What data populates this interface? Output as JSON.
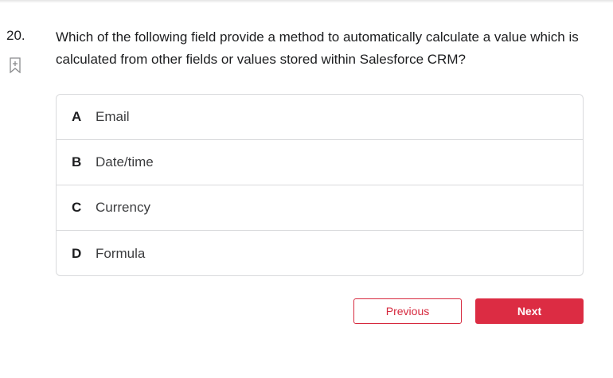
{
  "question": {
    "number": "20.",
    "text": "Which of the following field provide a method to automatically calculate a value which is calculated from other fields or values stored within Salesforce CRM?"
  },
  "options": [
    {
      "letter": "A",
      "text": "Email"
    },
    {
      "letter": "B",
      "text": "Date/time"
    },
    {
      "letter": "C",
      "text": "Currency"
    },
    {
      "letter": "D",
      "text": "Formula"
    }
  ],
  "nav": {
    "previous_label": "Previous",
    "next_label": "Next"
  },
  "colors": {
    "accent": "#dc2c43",
    "border": "#d9dadc",
    "text": "#1c1d1f"
  },
  "icons": {
    "bookmark": "bookmark-add-icon"
  }
}
